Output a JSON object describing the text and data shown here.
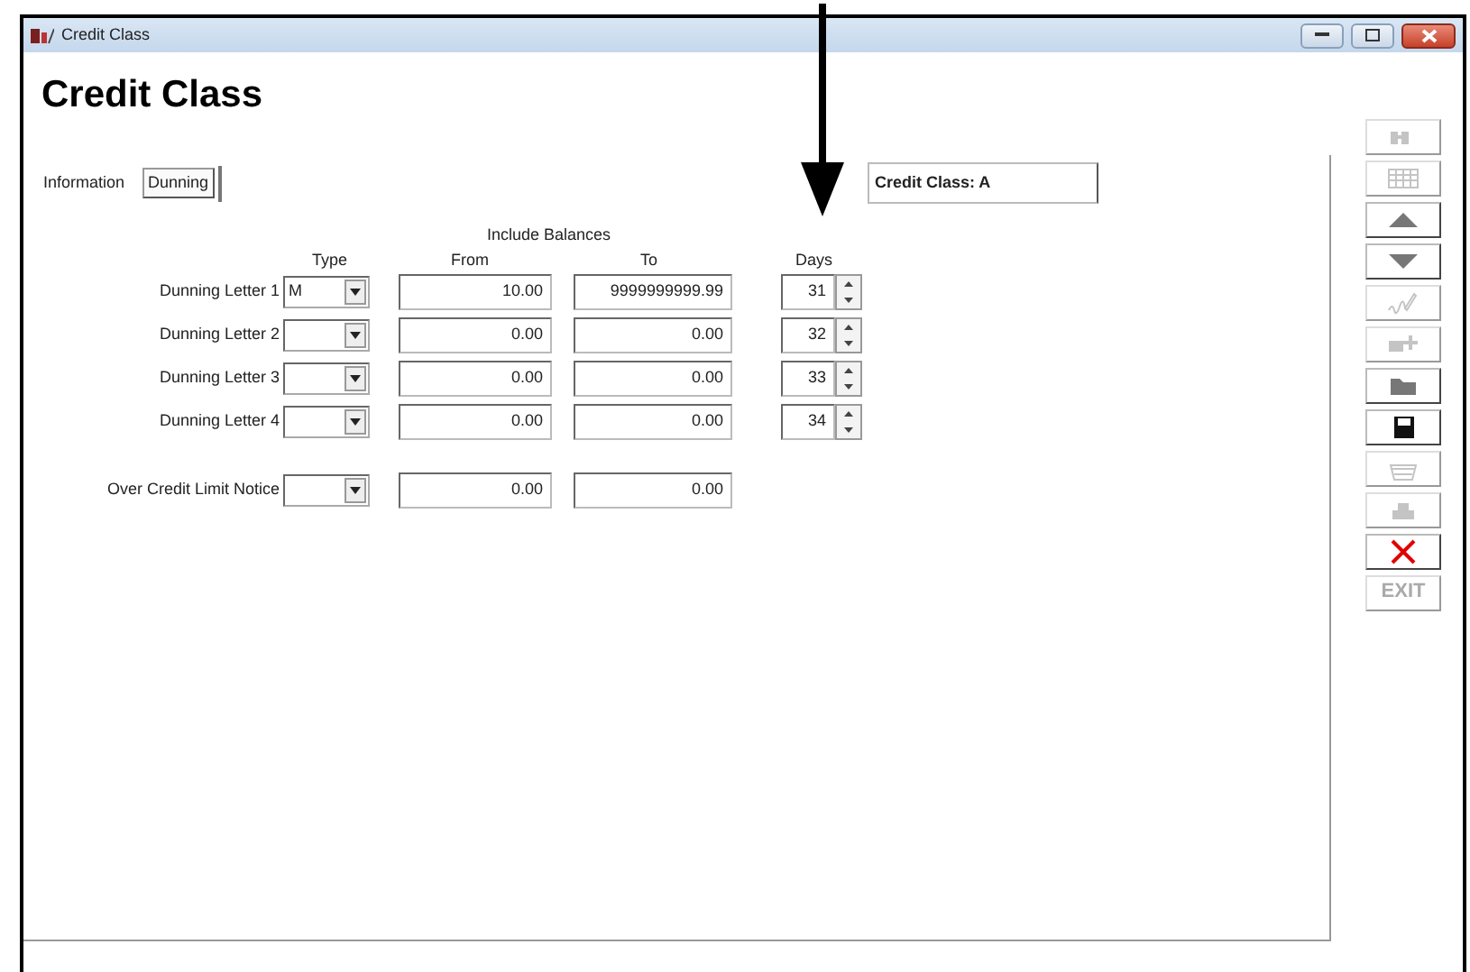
{
  "window": {
    "title": "Credit Class"
  },
  "heading": "Credit Class",
  "tabs": [
    {
      "label": "Information",
      "selected": false
    },
    {
      "label": "Dunning",
      "selected": true
    }
  ],
  "credit_class": "Credit Class: A",
  "group_header": "Include Balances",
  "columns": [
    "Type",
    "From",
    "To",
    "Days"
  ],
  "rows": [
    {
      "label": "Dunning Letter 1",
      "type": "M",
      "from": "10.00",
      "to": "9999999999.99",
      "days": "31"
    },
    {
      "label": "Dunning Letter 2",
      "from": "0.00",
      "to": "0.00",
      "days": "32"
    },
    {
      "label": "Dunning Letter 3",
      "from": "0.00",
      "to": "0.00",
      "days": "33"
    },
    {
      "label": "Dunning Letter 4",
      "from": "0.00",
      "to": "0.00",
      "days": "34"
    },
    {
      "label": "Over Credit Limit Notice",
      "from": "0.00",
      "to": "0.00"
    }
  ],
  "toolbar": [
    {
      "kind": "find",
      "disabled": true
    },
    {
      "kind": "grid",
      "disabled": true
    },
    {
      "kind": "up",
      "disabled": false
    },
    {
      "kind": "down",
      "disabled": false
    },
    {
      "kind": "sign",
      "disabled": true
    },
    {
      "kind": "add",
      "disabled": true
    },
    {
      "kind": "folder",
      "disabled": false
    },
    {
      "kind": "save",
      "disabled": false
    },
    {
      "kind": "basket",
      "disabled": true
    },
    {
      "kind": "print",
      "disabled": true
    },
    {
      "kind": "delete",
      "disabled": false
    },
    {
      "kind": "exit",
      "label": "EXIT",
      "disabled": true
    }
  ]
}
